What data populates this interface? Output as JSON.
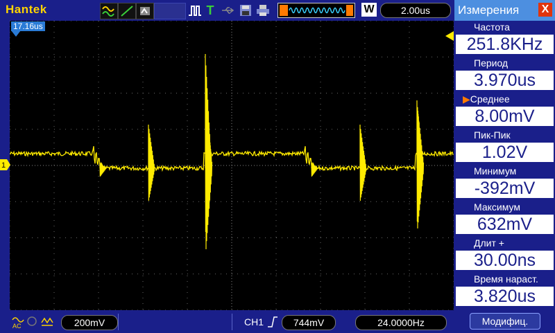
{
  "brand": "Hantek",
  "topbar": {
    "timebase": "2.00us",
    "mode_letter": "W",
    "trigger_mode_letter": "T"
  },
  "cursor_time": "17.16us",
  "bottom": {
    "volts_per_div": "200mV",
    "trigger_channel": "CH1",
    "trigger_level": "744mV",
    "frequency": "24.0000Hz"
  },
  "panel": {
    "title": "Измерения",
    "close_label": "X",
    "modify_label": "Модифиц.",
    "measurements": [
      {
        "label": "Частота",
        "value": "251.8KHz",
        "selected": false
      },
      {
        "label": "Период",
        "value": "3.970us",
        "selected": false
      },
      {
        "label": "Среднее",
        "value": "8.00mV",
        "selected": true
      },
      {
        "label": "Пик-Пик",
        "value": "1.02V",
        "selected": false
      },
      {
        "label": "Минимум",
        "value": "-392mV",
        "selected": false
      },
      {
        "label": "Максимум",
        "value": "632mV",
        "selected": false
      },
      {
        "label": "Длит +",
        "value": "30.00ns",
        "selected": false
      },
      {
        "label": "Время нараст.",
        "value": "3.820us",
        "selected": false
      }
    ]
  },
  "colors": {
    "trace": "#ffeb00",
    "panel_bg": "#1a1f8a",
    "header": "#4d8fe0",
    "close": "#e0340c",
    "selected_marker": "#ff7a00"
  },
  "channel_marker": "1"
}
